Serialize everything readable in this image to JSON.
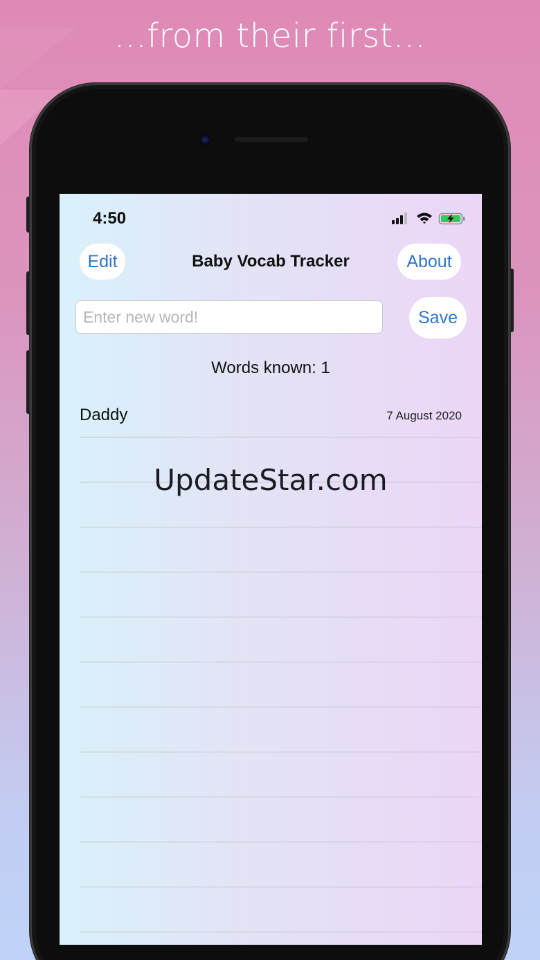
{
  "promo": {
    "tagline": "...from their first..."
  },
  "status_bar": {
    "time": "4:50",
    "icons": [
      "cellular-signal-icon",
      "wifi-icon",
      "battery-charging-icon"
    ]
  },
  "nav": {
    "edit_label": "Edit",
    "title": "Baby Vocab Tracker",
    "about_label": "About"
  },
  "entry": {
    "placeholder": "Enter new word!",
    "value": "",
    "save_label": "Save"
  },
  "summary": {
    "words_known": "Words known: 1"
  },
  "words": [
    {
      "word": "Daddy",
      "date": "7 August 2020"
    },
    {
      "word": "",
      "date": ""
    },
    {
      "word": "",
      "date": ""
    },
    {
      "word": "",
      "date": ""
    },
    {
      "word": "",
      "date": ""
    },
    {
      "word": "",
      "date": ""
    },
    {
      "word": "",
      "date": ""
    },
    {
      "word": "",
      "date": ""
    },
    {
      "word": "",
      "date": ""
    },
    {
      "word": "",
      "date": ""
    },
    {
      "word": "",
      "date": ""
    },
    {
      "word": "",
      "date": ""
    }
  ],
  "watermark": "UpdateStar.com",
  "colors": {
    "accent": "#2f74d0",
    "battery_fill": "#34c759"
  }
}
